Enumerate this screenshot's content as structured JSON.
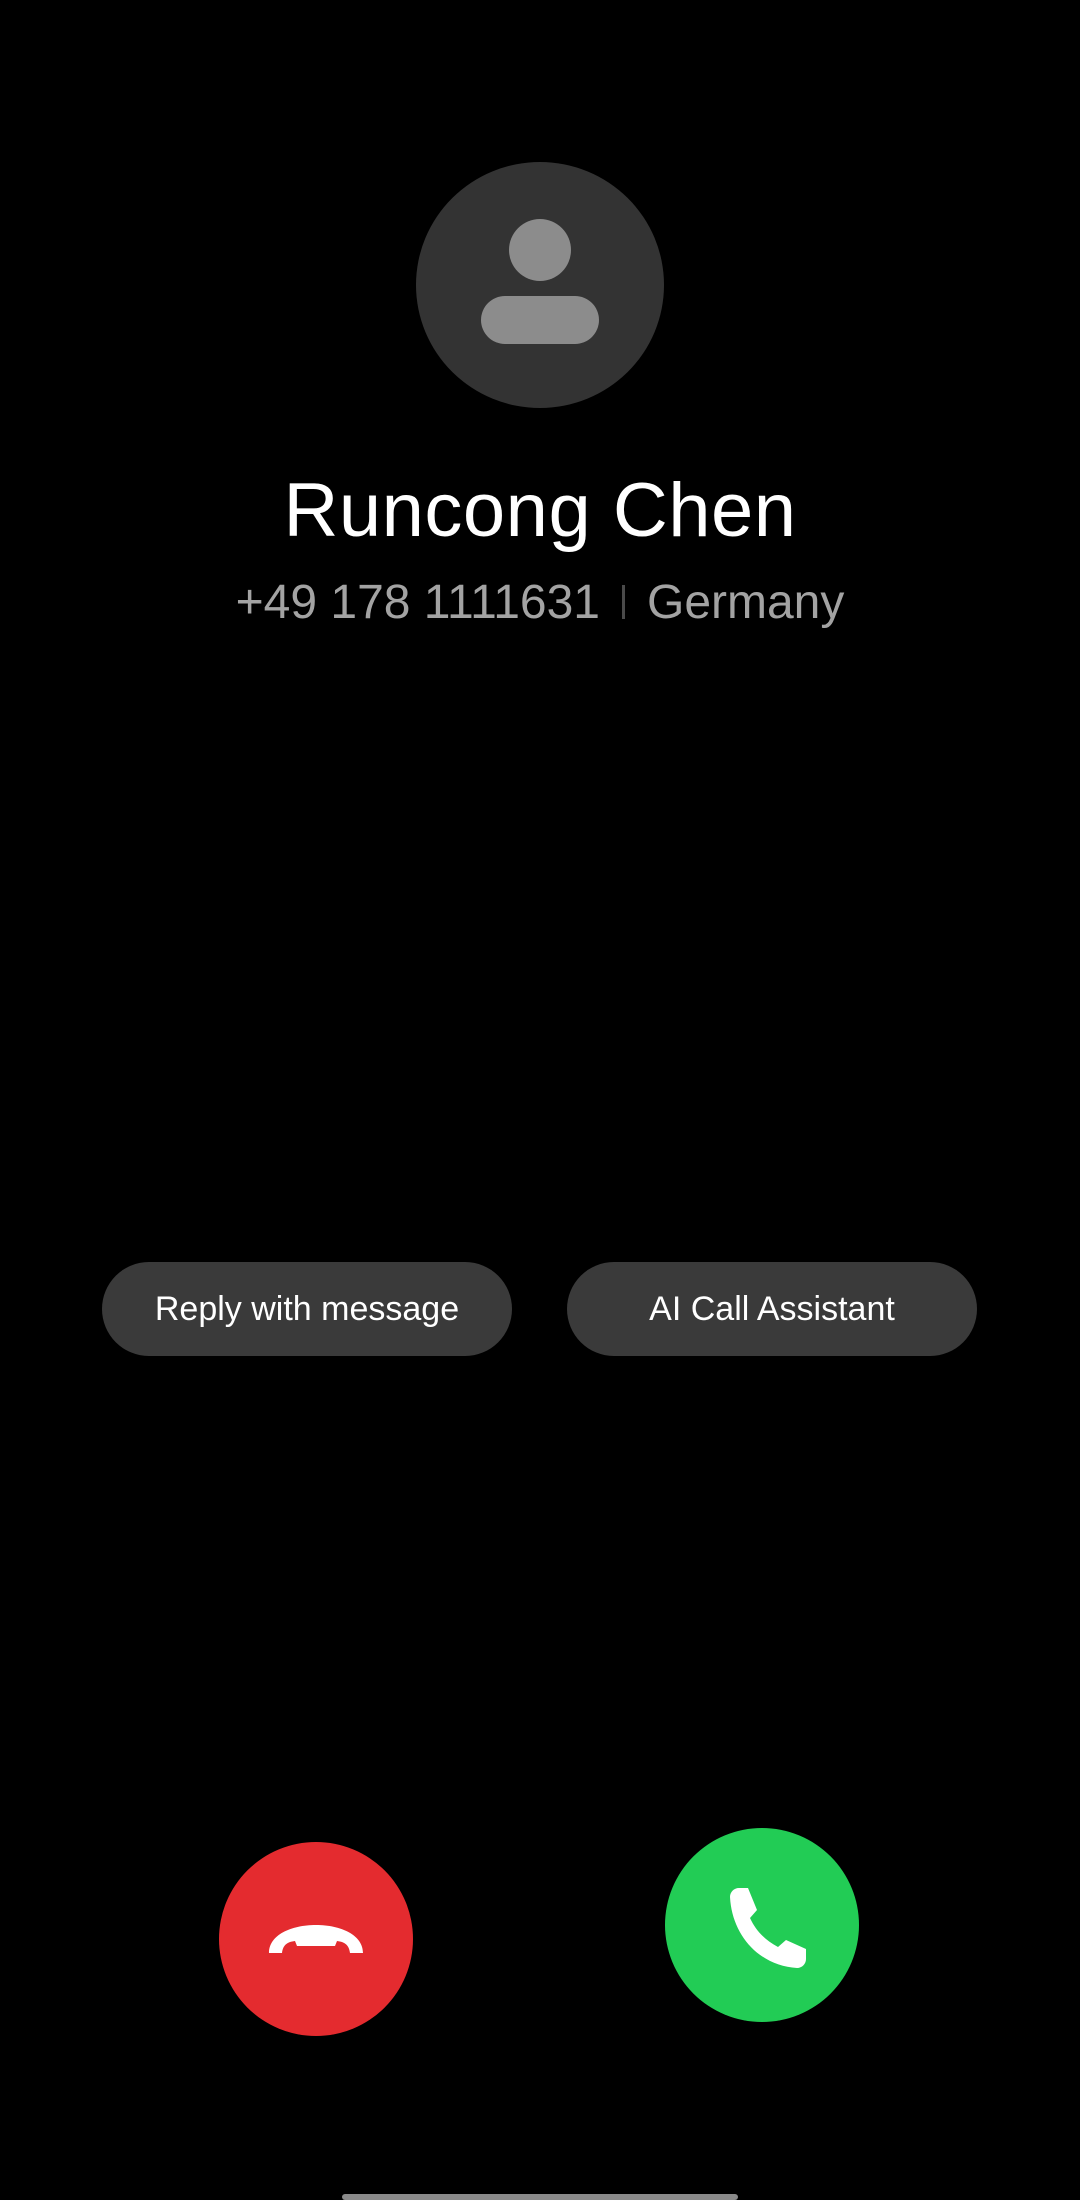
{
  "caller": {
    "name": "Runcong Chen",
    "number": "+49 178 1111631",
    "location": "Germany"
  },
  "actions": {
    "reply_label": "Reply with message",
    "ai_label": "AI Call Assistant"
  },
  "icons": {
    "avatar": "person-icon",
    "decline": "phone-hangup-icon",
    "accept": "phone-icon"
  },
  "colors": {
    "background": "#000000",
    "avatar_bg": "#333333",
    "avatar_glyph": "#8c8c8c",
    "pill_bg": "#3a3a3a",
    "decline": "#e42b2f",
    "accept": "#22cc55",
    "secondary_text": "#a3a3a3"
  }
}
